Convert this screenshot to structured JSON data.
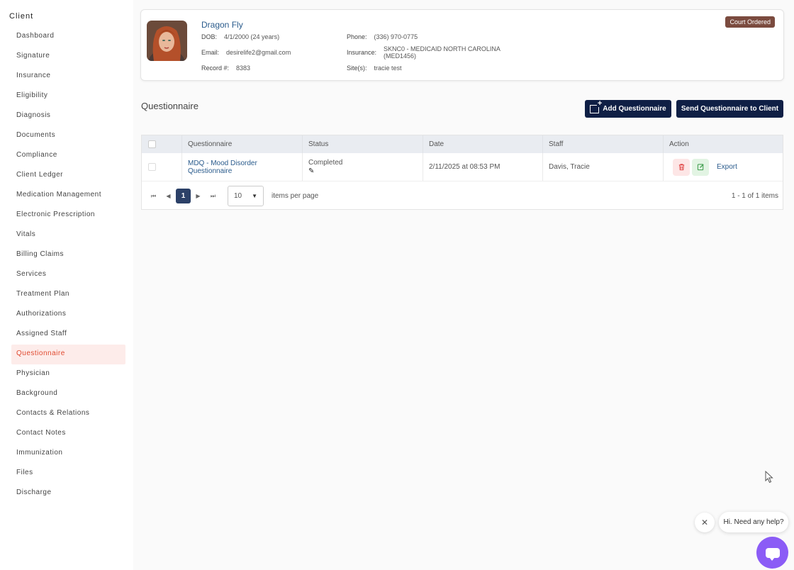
{
  "sidebar": {
    "title": "Client",
    "items": [
      {
        "label": "Dashboard"
      },
      {
        "label": "Signature"
      },
      {
        "label": "Insurance"
      },
      {
        "label": "Eligibility"
      },
      {
        "label": "Diagnosis"
      },
      {
        "label": "Documents"
      },
      {
        "label": "Compliance"
      },
      {
        "label": "Client Ledger"
      },
      {
        "label": "Medication Management"
      },
      {
        "label": "Electronic Prescription"
      },
      {
        "label": "Vitals"
      },
      {
        "label": "Billing Claims"
      },
      {
        "label": "Services"
      },
      {
        "label": "Treatment Plan"
      },
      {
        "label": "Authorizations"
      },
      {
        "label": "Assigned Staff"
      },
      {
        "label": "Questionnaire",
        "active": true
      },
      {
        "label": "Physician"
      },
      {
        "label": "Background"
      },
      {
        "label": "Contacts & Relations"
      },
      {
        "label": "Contact Notes"
      },
      {
        "label": "Immunization"
      },
      {
        "label": "Files"
      },
      {
        "label": "Discharge"
      }
    ]
  },
  "client": {
    "name": "Dragon Fly",
    "dob_label": "DOB:",
    "dob": "4/1/2000 (24 years)",
    "email_label": "Email:",
    "email": "desirelife2@gmail.com",
    "record_label": "Record #:",
    "record": "8383",
    "phone_label": "Phone:",
    "phone": "(336) 970-0775",
    "insurance_label": "Insurance:",
    "insurance_line1": "SKNC0 - MEDICAID NORTH CAROLINA",
    "insurance_line2": "(MED1456)",
    "sites_label": "Site(s):",
    "sites": "tracie test",
    "badge": "Court Ordered",
    "badge_color": "#7b4b3f"
  },
  "section": {
    "title": "Questionnaire",
    "add_button": "Add Questionnaire",
    "send_button": "Send Questionnaire to Client"
  },
  "table": {
    "headers": [
      "Questionnaire",
      "Status",
      "Date",
      "Staff",
      "Action"
    ],
    "rows": [
      {
        "questionnaire": "MDQ - Mood Disorder Questionnaire",
        "status": "Completed",
        "date": "2/11/2025 at 08:53 PM",
        "staff": "Davis, Tracie",
        "export": "Export"
      }
    ]
  },
  "pager": {
    "current_page": "1",
    "page_size": "10",
    "items_per_page": "items per page",
    "count": "1 - 1 of 1 items"
  },
  "chat": {
    "greeting": "Hi. Need any help?",
    "close_icon": "close-icon",
    "launcher_color": "#8b5cf6"
  },
  "colors": {
    "primary_button": "#0f1f45",
    "link": "#2a5b8c",
    "active_nav_bg": "#fdecea",
    "active_nav_text": "#e0492f"
  }
}
